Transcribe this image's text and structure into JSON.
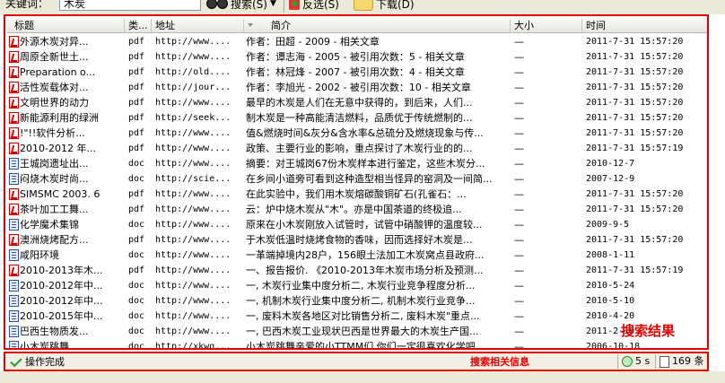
{
  "toolbar": {
    "keyword_label": "关键词：",
    "keyword_value": "木炭",
    "search_label": "搜索(S)",
    "invert_label": "反选(S)",
    "download_label": "下载(D)"
  },
  "table": {
    "columns": [
      "标题",
      "类...",
      "地址",
      "简介",
      "大小",
      "时间"
    ],
    "rows": [
      {
        "icon": "pdf",
        "title": "外源木炭对异...",
        "type": "pdf",
        "url": "http://www....",
        "summary": "作者：田超 - 2009 - 相关文章",
        "size": "—",
        "time": "2011-7-31 15:57:20"
      },
      {
        "icon": "pdf",
        "title": "周原全新世土...",
        "type": "pdf",
        "url": "http://www....",
        "summary": "作者：谭志海 - 2005 - 被引用次数：5 - 相关文章",
        "size": "—",
        "time": "2011-7-31 15:57:20"
      },
      {
        "icon": "pdf",
        "title": "Preparation o...",
        "type": "pdf",
        "url": "http://old....",
        "summary": "作者：林冠烽 - 2007 - 被引用次数：4 - 相关文章",
        "size": "—",
        "time": "2011-7-31 15:57:20"
      },
      {
        "icon": "pdf",
        "title": "活性炭载体对...",
        "type": "pdf",
        "url": "http://jour...",
        "summary": "作者：李旭光 - 2002 - 被引用次数：10 - 相关文章",
        "size": "—",
        "time": "2011-7-31 15:57:20"
      },
      {
        "icon": "pdf",
        "title": "文明世界的动力",
        "type": "pdf",
        "url": "http://www....",
        "summary": "最早的木炭是人们在无意中获得的，到后来，人们...",
        "size": "—",
        "time": "2011-7-31 15:57:20"
      },
      {
        "icon": "pdf",
        "title": "新能源利用的绿洲",
        "type": "pdf",
        "url": "http://seek...",
        "summary": "制木炭是一种高能清洁燃料，品质优于传统燃制的...",
        "size": "—",
        "time": "2011-7-31 15:57:20"
      },
      {
        "icon": "pdf",
        "title": "!\"!!软件分析...",
        "type": "pdf",
        "url": "http://www....",
        "summary": "值&燃烧时间&灰分&含水率&总硫分及燃烧现象与传...",
        "size": "—",
        "time": "2011-7-31 15:57:20"
      },
      {
        "icon": "pdf",
        "title": "2010-2012 年...",
        "type": "pdf",
        "url": "http://www....",
        "summary": "政策、主要行业的影响，重点探讨了木炭行业的的...",
        "size": "—",
        "time": "2011-7-31 15:57:19"
      },
      {
        "icon": "doc",
        "title": "王城岗遗址出...",
        "type": "doc",
        "url": "http://www....",
        "summary": "摘要：对王城岗67份木炭样本进行鉴定，这些木炭分...",
        "size": "—",
        "time": "2010-12-7"
      },
      {
        "icon": "doc",
        "title": "闷烧木炭时尚...",
        "type": "doc",
        "url": "http://scie...",
        "summary": "在乡间小道旁可看到这种造型相当怪异的窑洞及一间简...",
        "size": "—",
        "time": "2007-12-9"
      },
      {
        "icon": "pdf",
        "title": "SIMSMC 2003. 6",
        "type": "pdf",
        "url": "http://www....",
        "summary": "在此实验中，我们用木炭熔碳酸铜矿石(孔雀石：...",
        "size": "—",
        "time": "2011-7-31 15:57:20"
      },
      {
        "icon": "pdf",
        "title": "茶叶加工工舞...",
        "type": "pdf",
        "url": "http://www....",
        "summary": "云：炉中烧木炭从\"木\"。亦是中国茶道的终极追...",
        "size": "—",
        "time": "2011-7-31 15:57:20"
      },
      {
        "icon": "doc",
        "title": "化学魔术集锦",
        "type": "doc",
        "url": "http://www....",
        "summary": "原来在小木炭刚放入试管时，试管中硝酸钾的温度较...",
        "size": "—",
        "time": "2009-9-5"
      },
      {
        "icon": "pdf",
        "title": "澳洲烧烤配方...",
        "type": "pdf",
        "url": "http://www....",
        "summary": "于木炭低温时烧烤食物的香味，因而选择好木炭是...",
        "size": "—",
        "time": "2011-7-31 15:57:20"
      },
      {
        "icon": "doc",
        "title": "咸阳环境",
        "type": "doc",
        "url": "http://www....",
        "summary": "一革端掉境内28户，156眼土法加工木炭窝点县政府...",
        "size": "—",
        "time": "2008-1-11"
      },
      {
        "icon": "pdf",
        "title": "2010-2013年木...",
        "type": "pdf",
        "url": "http://www....",
        "summary": "一、报告报价. 《2010-2013年木炭市场分析及预测...",
        "size": "—",
        "time": "2011-7-31 15:57:19"
      },
      {
        "icon": "doc",
        "title": "2010-2012年中...",
        "type": "doc",
        "url": "http://www....",
        "summary": "一, 木炭行业集中度分析二, 木炭行业竞争程度分析...",
        "size": "—",
        "time": "2010-5-24"
      },
      {
        "icon": "doc",
        "title": "2010-2012年中...",
        "type": "doc",
        "url": "http://www....",
        "summary": "一, 机制木炭行业集中度分析二, 机制木炭行业竞争...",
        "size": "—",
        "time": "2010-5-10"
      },
      {
        "icon": "doc",
        "title": "2010-2015年中...",
        "type": "doc",
        "url": "http://www....",
        "summary": "一, 废料木炭各地区对比销售分析二, 废料木炭\"重点...",
        "size": "—",
        "time": "2010-4-20"
      },
      {
        "icon": "doc",
        "title": "巴西生物质发...",
        "type": "doc",
        "url": "http://www....",
        "summary": "一, 巴西木炭工业现状巴西是世界最大的木炭生产国...",
        "size": "—",
        "time": "2011-2-19"
      },
      {
        "icon": "doc",
        "title": "小木炭跳舞",
        "type": "doc",
        "url": "http://xkwg...",
        "summary": "小木炭跳舞亲爱的小TTMM们,你们一定很喜欢化学吧...",
        "size": "—",
        "time": "2006-10-18"
      }
    ]
  },
  "annotations": {
    "results_label": "搜索结果",
    "status_label": "搜索相关信息"
  },
  "status": {
    "message": "操作完成",
    "elapsed": "5 s",
    "count": "169 条"
  }
}
